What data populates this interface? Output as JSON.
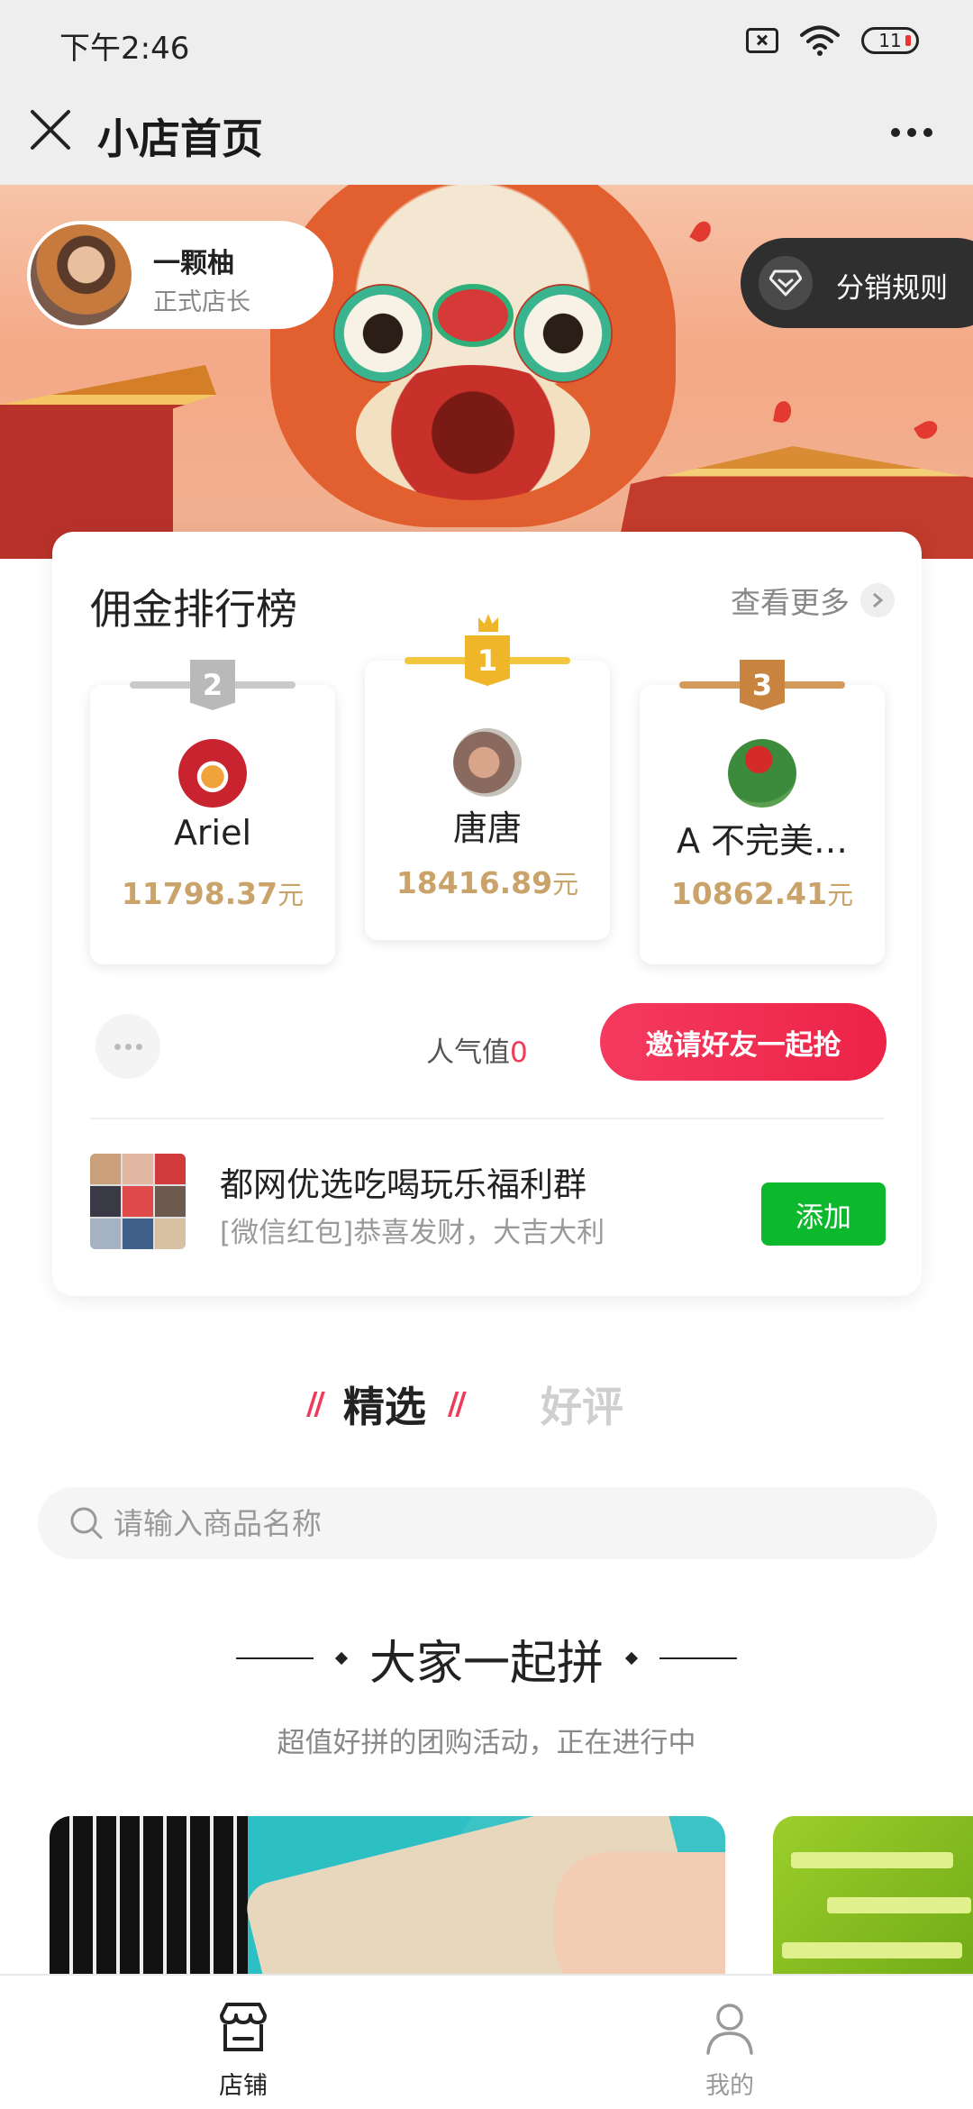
{
  "status_bar": {
    "time": "下午2:46",
    "battery": "11"
  },
  "title_bar": {
    "title": "小店首页"
  },
  "banner": {
    "user_name": "一颗柚",
    "user_role": "正式店长",
    "rules_label": "分销规则"
  },
  "ranking": {
    "title": "佣金排行榜",
    "more_label": "查看更多",
    "items": [
      {
        "rank": "2",
        "name": "Ariel",
        "amount": "11798.37",
        "unit": "元"
      },
      {
        "rank": "1",
        "name": "唐唐",
        "amount": "18416.89",
        "unit": "元"
      },
      {
        "rank": "3",
        "name": "A 不完美…",
        "amount": "10862.41",
        "unit": "元"
      }
    ],
    "popularity_label": "人气值",
    "popularity_value": "0",
    "invite_label": "邀请好友一起抢"
  },
  "group": {
    "name": "都网优选吃喝玩乐福利群",
    "message": "[微信红包]恭喜发财，大吉大利",
    "add_label": "添加"
  },
  "tabs": {
    "active": "精选",
    "inactive": "好评"
  },
  "search": {
    "placeholder": "请输入商品名称"
  },
  "section": {
    "title": "大家一起拼",
    "subtitle": "超值好拼的团购活动，正在进行中"
  },
  "bottom_nav": [
    {
      "label": "店铺",
      "icon": "store-icon",
      "active": true
    },
    {
      "label": "我的",
      "icon": "person-icon",
      "active": false
    }
  ],
  "colors": {
    "accent": "#f03a5a",
    "gold": "#c9a36a",
    "green": "#0cb82c",
    "rank1": "#f0b62a",
    "rank2": "#b9b9b9",
    "rank3": "#c9853f"
  }
}
